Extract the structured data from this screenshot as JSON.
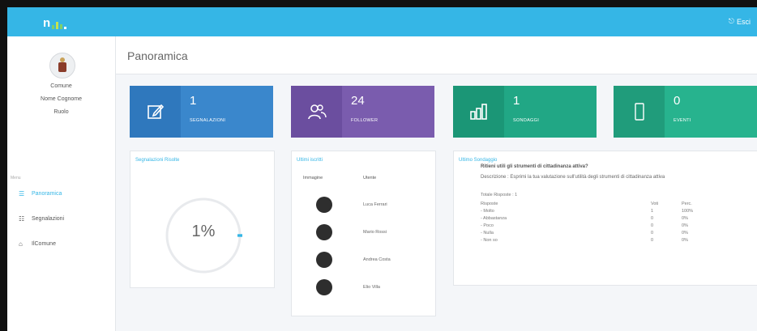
{
  "topbar": {
    "logout_label": "Esci"
  },
  "sidebar": {
    "info": [
      "Comune",
      "Nome Cognome",
      "Ruolo"
    ],
    "menu_label": "Menu",
    "items": [
      {
        "label": "Panoramica",
        "icon": "list-icon"
      },
      {
        "label": "Segnalazioni",
        "icon": "list-icon"
      },
      {
        "label": "IlComune",
        "icon": "building-icon"
      }
    ]
  },
  "page": {
    "title": "Panoramica"
  },
  "tiles": [
    {
      "value": "1",
      "label": "SEGNALAZIONI",
      "color": "#3a87cc",
      "icon_bg": "#2f78bd",
      "icon": "edit-icon"
    },
    {
      "value": "24",
      "label": "FOLLOWER",
      "color": "#7a5cae",
      "icon_bg": "#6b4e9f",
      "icon": "users-icon"
    },
    {
      "value": "1",
      "label": "SONDAGGI",
      "color": "#21a785",
      "icon_bg": "#1b9676",
      "icon": "chart-icon"
    },
    {
      "value": "0",
      "label": "EVENTI",
      "color": "#27b38e",
      "icon_bg": "#209c7b",
      "icon": "phone-icon"
    }
  ],
  "panel_progress": {
    "title": "Segnalazioni Risolte",
    "value_text": "1%",
    "fraction": 0.01
  },
  "panel_users": {
    "title": "Ultimi iscritti",
    "col1": "Immagine",
    "col2": "Utente",
    "users": [
      "Luca Ferrari",
      "Mario Rossi",
      "Andrea Costa",
      "Elio Villa"
    ]
  },
  "panel_survey": {
    "title": "Ultimo Sondaggio",
    "question": "Ritieni utili gli strumenti di cittadinanza attiva?",
    "description": "Descrizione : Esprimi la tua valutazione sull'utilità degli strumenti di cittadinanza attiva",
    "total": "Totale Risposte : 1",
    "headers": [
      "Risposte",
      "Voti",
      "Perc."
    ],
    "rows": [
      [
        "- Molto",
        "1",
        "100%"
      ],
      [
        "- Abbastanza",
        "0",
        "0%"
      ],
      [
        "- Poco",
        "0",
        "0%"
      ],
      [
        "- Nulla",
        "0",
        "0%"
      ],
      [
        "- Non so",
        "0",
        "0%"
      ]
    ]
  }
}
